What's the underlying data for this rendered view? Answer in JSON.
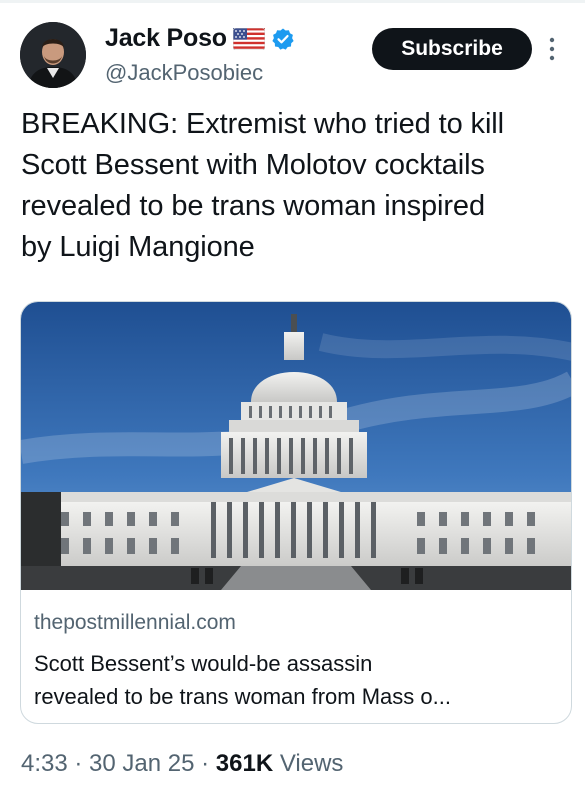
{
  "author": {
    "display_name": "Jack Poso",
    "handle": "@JackPosobiec",
    "flag_icon": "us-flag-icon",
    "verified_icon": "verified-badge-icon",
    "verified_color": "#1d9bf0"
  },
  "actions": {
    "subscribe_label": "Subscribe",
    "more_icon": "vertical-ellipsis-icon"
  },
  "tweet": {
    "lines": [
      "BREAKING: Extremist who tried to kill",
      "Scott Bessent with Molotov cocktails",
      "revealed to be trans woman inspired",
      "by Luigi Mangione"
    ]
  },
  "link_card": {
    "image": "us-capitol-building-photo",
    "domain": "thepostmillennial.com",
    "title_lines": [
      "Scott Bessent’s would-be assassin",
      "revealed to be trans woman from Mass o..."
    ]
  },
  "meta": {
    "time": "4:33",
    "sep1": " · ",
    "date": "30 Jan 25",
    "sep2": " · ",
    "views_count": "361K",
    "views_label": " Views"
  },
  "colors": {
    "text": "#0f1419",
    "secondary": "#536471",
    "button_bg": "#0f1419",
    "border": "#cfd9de"
  }
}
